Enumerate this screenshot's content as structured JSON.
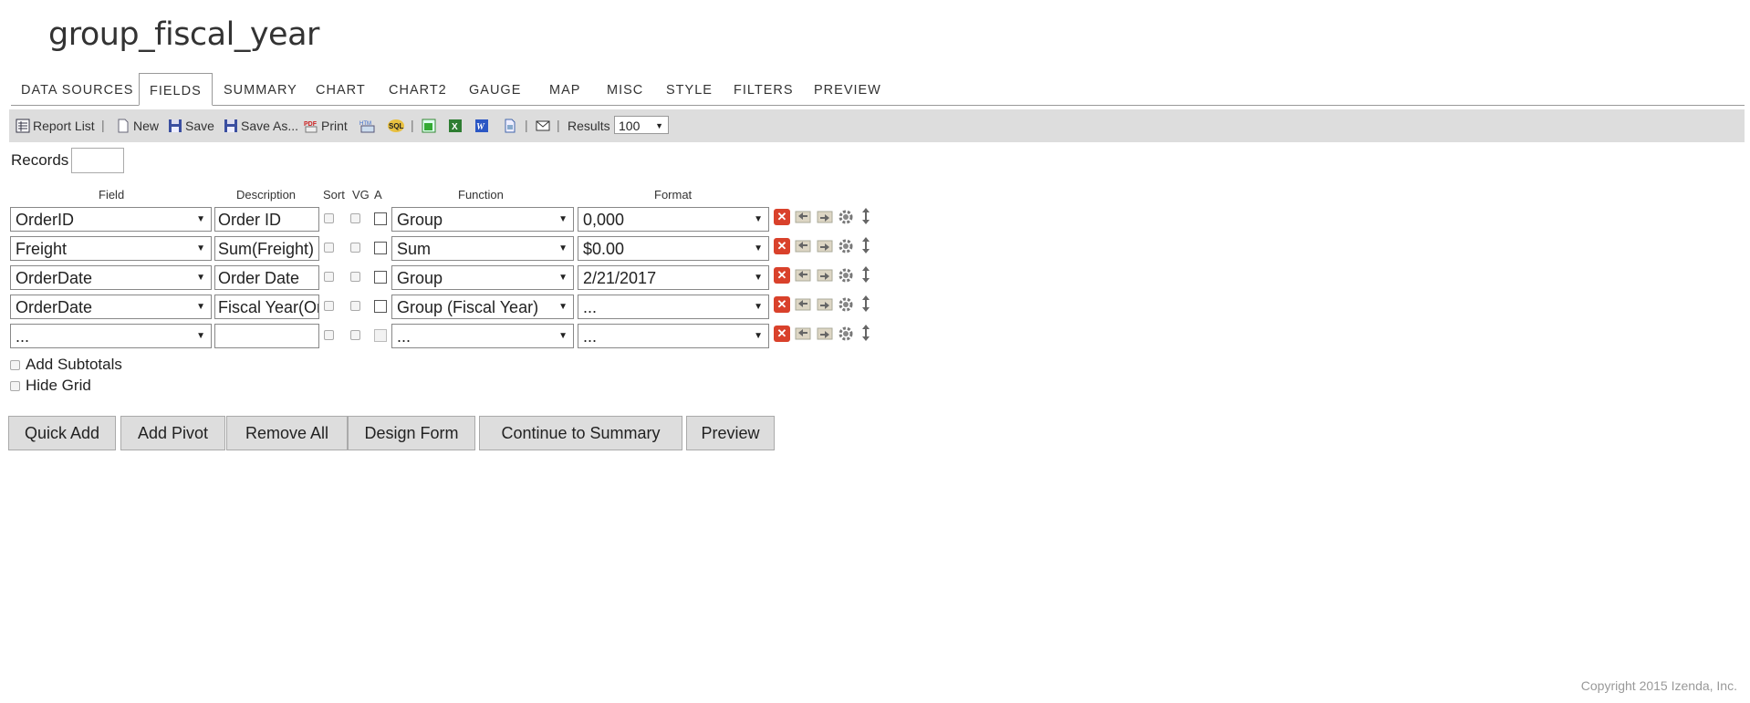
{
  "page_title": "group_fiscal_year",
  "tabs": [
    "DATA SOURCES",
    "FIELDS",
    "SUMMARY",
    "CHART",
    "CHART2",
    "GAUGE",
    "MAP",
    "MISC",
    "STYLE",
    "FILTERS",
    "PREVIEW"
  ],
  "active_tab": "FIELDS",
  "toolbar": {
    "report_list": "Report List",
    "new": "New",
    "save": "Save",
    "save_as": "Save As...",
    "print": "Print",
    "results_label": "Results",
    "results_value": "100",
    "separator": "|"
  },
  "records_label": "Records",
  "columns": {
    "field": "Field",
    "description": "Description",
    "sort": "Sort",
    "vg": "VG",
    "a": "A",
    "function": "Function",
    "format": "Format"
  },
  "rows": [
    {
      "field": "OrderID",
      "description": "Order ID",
      "function": "Group",
      "format": "0,000"
    },
    {
      "field": "Freight",
      "description": "Sum(Freight)",
      "function": "Sum",
      "format": "$0.00"
    },
    {
      "field": "OrderDate",
      "description": "Order Date",
      "function": "Group",
      "format": "2/21/2017"
    },
    {
      "field": "OrderDate",
      "description": "Fiscal Year(OrderDate)",
      "function": "Group (Fiscal Year)",
      "format": "..."
    },
    {
      "field": "...",
      "description": "",
      "function": "...",
      "format": "..."
    }
  ],
  "options": {
    "add_subtotals": "Add Subtotals",
    "hide_grid": "Hide Grid"
  },
  "buttons": {
    "quick_add": "Quick Add",
    "add_pivot": "Add Pivot",
    "remove_all": "Remove All",
    "design_form": "Design Form",
    "continue": "Continue to Summary",
    "preview": "Preview"
  },
  "copyright": "Copyright 2015 Izenda, Inc.",
  "colors": {
    "toolbar_bg": "#dddddd",
    "delete_red": "#d9412b",
    "button_bg": "#dddddd"
  }
}
